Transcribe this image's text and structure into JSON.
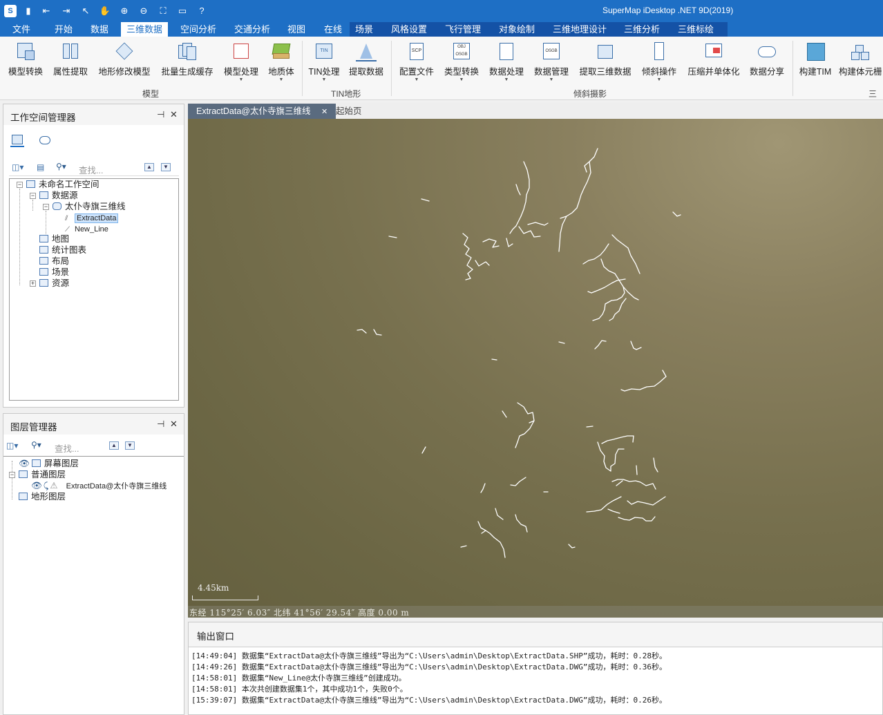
{
  "app": {
    "title": "SuperMap iDesktop .NET 9D(2019)"
  },
  "menu": {
    "items": [
      {
        "label": "文件"
      },
      {
        "label": "开始"
      },
      {
        "label": "数据"
      },
      {
        "label": "三维数据"
      },
      {
        "label": "空间分析"
      },
      {
        "label": "交通分析"
      },
      {
        "label": "视图"
      },
      {
        "label": "在线"
      },
      {
        "label": "场景"
      },
      {
        "label": "风格设置"
      },
      {
        "label": "飞行管理"
      },
      {
        "label": "对象绘制"
      },
      {
        "label": "三维地理设计"
      },
      {
        "label": "三维分析"
      },
      {
        "label": "三维标绘"
      }
    ]
  },
  "ribbon": {
    "buttons": [
      {
        "label": "模型转换",
        "icon": "model-convert-icon"
      },
      {
        "label": "属性提取",
        "icon": "attribute-extract-icon"
      },
      {
        "label": "地形修改模型",
        "icon": "terrain-modify-icon"
      },
      {
        "label": "批量生成缓存",
        "icon": "batch-cache-icon"
      },
      {
        "label": "模型处理",
        "icon": "model-process-icon"
      },
      {
        "label": "地质体",
        "icon": "geology-body-icon"
      },
      {
        "label": "TIN处理",
        "icon": "tin-process-icon"
      },
      {
        "label": "提取数据",
        "icon": "extract-data-icon"
      },
      {
        "label": "配置文件",
        "icon": "config-file-icon"
      },
      {
        "label": "类型转换",
        "icon": "type-convert-icon"
      },
      {
        "label": "数据处理",
        "icon": "data-process-icon"
      },
      {
        "label": "数据管理",
        "icon": "data-manage-icon"
      },
      {
        "label": "提取三维数据",
        "icon": "extract-3d-icon"
      },
      {
        "label": "倾斜操作",
        "icon": "oblique-op-icon"
      },
      {
        "label": "压缩并单体化",
        "icon": "compress-icon"
      },
      {
        "label": "数据分享",
        "icon": "data-share-icon"
      },
      {
        "label": "构建TIM",
        "icon": "build-tim-icon"
      },
      {
        "label": "构建体元栅",
        "icon": "build-voxel-icon"
      }
    ],
    "groups": [
      {
        "label": "模型"
      },
      {
        "label": "TIN地形"
      },
      {
        "label": "倾斜摄影"
      },
      {
        "label": "三"
      }
    ]
  },
  "workspace_panel": {
    "title": "工作空间管理器",
    "search_placeholder": "查找...",
    "tree": {
      "root": "未命名工作空间",
      "datasources": "数据源",
      "datasource": "太仆寺旗三维线",
      "dataset1": "ExtractData",
      "dataset2": "New_Line",
      "maps": "地图",
      "charts": "统计图表",
      "layouts": "布局",
      "scenes": "场景",
      "resources": "资源"
    }
  },
  "layer_panel": {
    "title": "图层管理器",
    "search_placeholder": "查找...",
    "tree": {
      "screen": "屏幕图层",
      "normal": "普通图层",
      "layer": "ExtractData@太仆寺旗三维线",
      "terrain": "地形图层"
    }
  },
  "doc_tabs": [
    {
      "label": "ExtractData@太仆寺旗三维线"
    },
    {
      "label": "起始页"
    }
  ],
  "scene": {
    "scale": "4.45km",
    "coords": "东经 115°25′ 6.03″   北纬 41°56′ 29.54″   高度 0.00 m"
  },
  "output": {
    "title": "输出窗口",
    "lines": [
      "[14:49:04] 数据集“ExtractData@太仆寺旗三维线”导出为“C:\\Users\\admin\\Desktop\\ExtractData.SHP”成功，耗时：0.28秒。",
      "[14:49:26] 数据集“ExtractData@太仆寺旗三维线”导出为“C:\\Users\\admin\\Desktop\\ExtractData.DWG”成功，耗时：0.36秒。",
      "[14:58:01] 数据集“New_Line@太仆寺旗三维线”创建成功。",
      "[14:58:01] 本次共创建数据集1个，其中成功1个，失败0个。",
      "[15:39:07] 数据集“ExtractData@太仆寺旗三维线”导出为“C:\\Users\\admin\\Desktop\\ExtractData.DWG”成功，耗时：0.26秒。"
    ]
  },
  "colors": {
    "accent": "#1e6fc5",
    "scene": "#7a7352",
    "lines": "#ffffff"
  }
}
